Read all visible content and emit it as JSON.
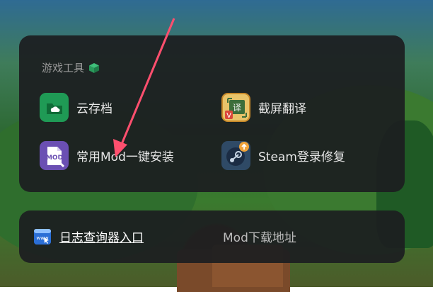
{
  "section_title": "游戏工具",
  "tools": [
    {
      "label": "云存档",
      "icon": "cloud-folder-icon"
    },
    {
      "label": "截屏翻译",
      "icon": "screenshot-translate-icon"
    },
    {
      "label": "常用Mod一键安装",
      "icon": "mod-install-icon"
    },
    {
      "label": "Steam登录修复",
      "icon": "steam-repair-icon"
    }
  ],
  "bottom_links": {
    "log_label": "日志查询器入口",
    "log_icon": "www-icon",
    "mod_download_label": "Mod下载地址"
  },
  "colors": {
    "panel_bg": "#1c1e20",
    "accent_green": "#1f9a55",
    "arrow_pink": "#ff4f6e"
  }
}
